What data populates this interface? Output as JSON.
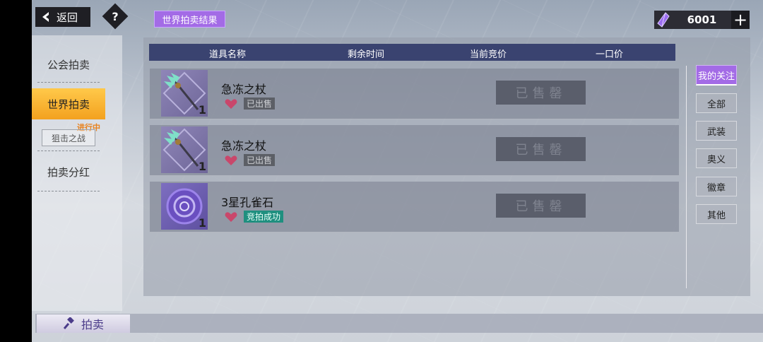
{
  "header": {
    "back_label": "返回",
    "help_label": "?",
    "result_button": "世界拍卖结果",
    "currency_amount": "6001",
    "currency_plus": "+"
  },
  "sidebar": {
    "items": [
      {
        "label": "公会拍卖"
      },
      {
        "label": "世界拍卖"
      },
      {
        "label": "拍卖分红"
      }
    ],
    "sub_item": "狙击之战",
    "sub_badge": "进行中"
  },
  "table": {
    "columns": [
      "道具名称",
      "剩余时间",
      "当前竞价",
      "一口价"
    ],
    "rows": [
      {
        "name": "急冻之杖",
        "status": "已出售",
        "action": "已售罄",
        "qty": "1",
        "icon": "frost-staff-icon"
      },
      {
        "name": "急冻之杖",
        "status": "已出售",
        "action": "已售罄",
        "qty": "1",
        "icon": "frost-staff-icon"
      },
      {
        "name": "3星孔雀石",
        "status": "竞拍成功",
        "action": "已售罄",
        "qty": "1",
        "icon": "malachite-stone-icon"
      }
    ]
  },
  "filters": [
    "我的关注",
    "全部",
    "武装",
    "奥义",
    "徽章",
    "其他"
  ],
  "bottom": {
    "auction_tab": "拍卖"
  },
  "colors": {
    "accent": "#a36be6",
    "active_tab": "#f3a11f",
    "header_bg": "#3a4370",
    "won": "#1f8f7f"
  }
}
